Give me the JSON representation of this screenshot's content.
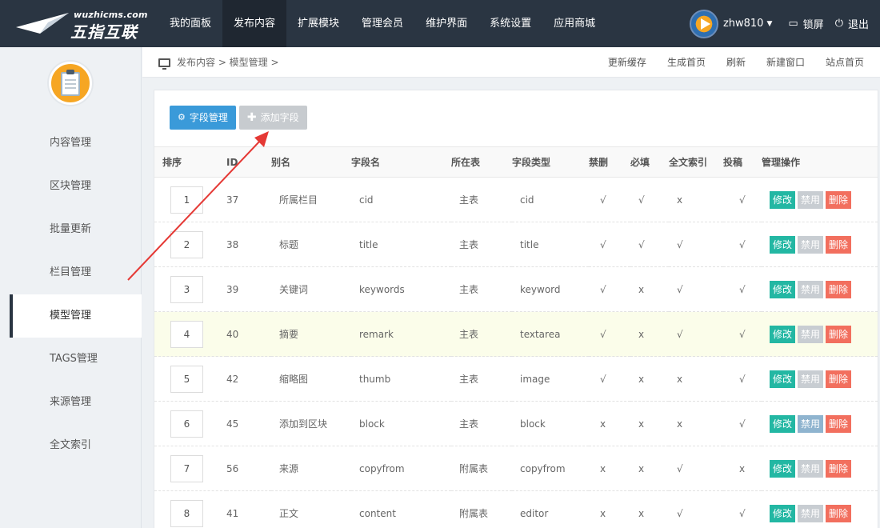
{
  "logo": {
    "site": "wuzhicms.com",
    "name": "五指互联"
  },
  "nav": [
    {
      "label": "我的面板",
      "active": false
    },
    {
      "label": "发布内容",
      "active": true
    },
    {
      "label": "扩展模块",
      "active": false
    },
    {
      "label": "管理会员",
      "active": false
    },
    {
      "label": "维护界面",
      "active": false
    },
    {
      "label": "系统设置",
      "active": false
    },
    {
      "label": "应用商城",
      "active": false
    }
  ],
  "user": {
    "name": "zhw810",
    "lock_label": "锁屏",
    "logout_label": "退出"
  },
  "sidebar": {
    "items": [
      {
        "label": "内容管理"
      },
      {
        "label": "区块管理"
      },
      {
        "label": "批量更新"
      },
      {
        "label": "栏目管理"
      },
      {
        "label": "模型管理"
      },
      {
        "label": "TAGS管理"
      },
      {
        "label": "来源管理"
      },
      {
        "label": "全文索引"
      }
    ],
    "active_index": 4
  },
  "breadcrumb": {
    "text": "发布内容 > 模型管理 >"
  },
  "crumb_links": [
    "更新缓存",
    "生成首页",
    "刷新",
    "新建窗口",
    "站点首页"
  ],
  "toolbar": {
    "field_manage_label": "字段管理",
    "add_field_label": "添加字段"
  },
  "table": {
    "headers": [
      "排序",
      "ID",
      "别名",
      "字段名",
      "所在表",
      "字段类型",
      "禁删",
      "必填",
      "全文索引",
      "投稿",
      "管理操作"
    ],
    "rows": [
      {
        "order": "1",
        "id": "37",
        "alias": "所属栏目",
        "field": "cid",
        "table": "主表",
        "type": "cid",
        "nodel": "√",
        "required": "√",
        "fulltext": "x",
        "submit": "√",
        "highlight": false,
        "disable_active": false
      },
      {
        "order": "2",
        "id": "38",
        "alias": "标题",
        "field": "title",
        "table": "主表",
        "type": "title",
        "nodel": "√",
        "required": "√",
        "fulltext": "√",
        "submit": "√",
        "highlight": false,
        "disable_active": false
      },
      {
        "order": "3",
        "id": "39",
        "alias": "关键词",
        "field": "keywords",
        "table": "主表",
        "type": "keyword",
        "nodel": "√",
        "required": "x",
        "fulltext": "√",
        "submit": "√",
        "highlight": false,
        "disable_active": false
      },
      {
        "order": "4",
        "id": "40",
        "alias": "摘要",
        "field": "remark",
        "table": "主表",
        "type": "textarea",
        "nodel": "√",
        "required": "x",
        "fulltext": "√",
        "submit": "√",
        "highlight": true,
        "disable_active": false
      },
      {
        "order": "5",
        "id": "42",
        "alias": "缩略图",
        "field": "thumb",
        "table": "主表",
        "type": "image",
        "nodel": "√",
        "required": "x",
        "fulltext": "x",
        "submit": "√",
        "highlight": false,
        "disable_active": false
      },
      {
        "order": "6",
        "id": "45",
        "alias": "添加到区块",
        "field": "block",
        "table": "主表",
        "type": "block",
        "nodel": "x",
        "required": "x",
        "fulltext": "x",
        "submit": "√",
        "highlight": false,
        "disable_active": true
      },
      {
        "order": "7",
        "id": "56",
        "alias": "来源",
        "field": "copyfrom",
        "table": "附属表",
        "type": "copyfrom",
        "nodel": "x",
        "required": "x",
        "fulltext": "√",
        "submit": "x",
        "highlight": false,
        "disable_active": false
      },
      {
        "order": "8",
        "id": "41",
        "alias": "正文",
        "field": "content",
        "table": "附属表",
        "type": "editor",
        "nodel": "x",
        "required": "x",
        "fulltext": "√",
        "submit": "√",
        "highlight": false,
        "disable_active": false
      }
    ],
    "ops": {
      "edit": "修改",
      "disable": "禁用",
      "delete": "删除"
    }
  },
  "colors": {
    "topbar": "#2a3542",
    "accent": "#3a9ad9",
    "edit": "#23b7a3",
    "delete": "#f26f5e",
    "arrow": "#e53935"
  }
}
